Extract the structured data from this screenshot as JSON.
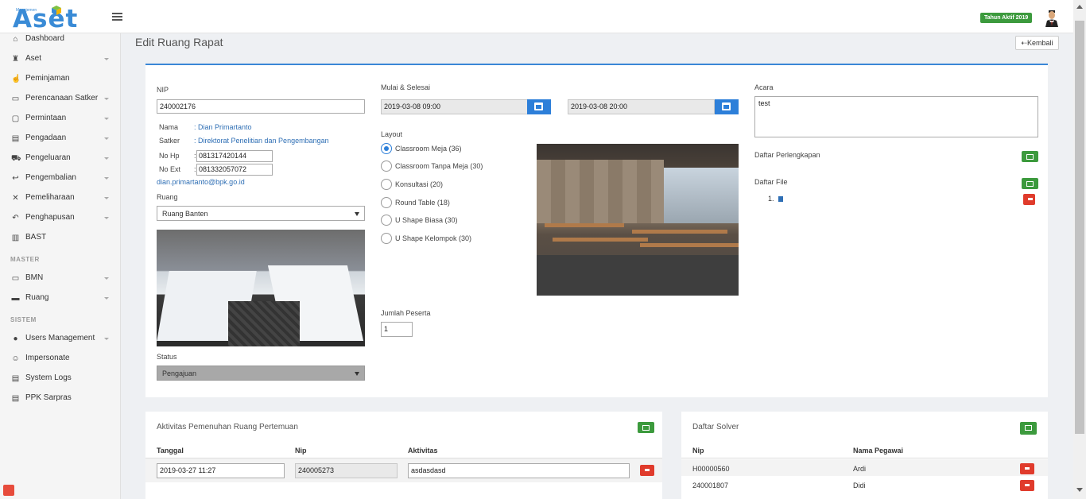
{
  "app": {
    "logo_small": "Manajemen",
    "logo_text": "Aset",
    "tahun_badge": "Tahun Aktif 2019",
    "brand_color": "#3a8bd6",
    "accent_color": "#2d7fd9",
    "success_color": "#3c9a3d",
    "danger_color": "#e03b2c"
  },
  "sidebar": {
    "items": [
      {
        "label": "Dashboard",
        "icon": "home-icon",
        "glyph": "⌂",
        "caret": false
      },
      {
        "label": "Aset",
        "icon": "chair-icon",
        "glyph": "♜",
        "caret": true
      },
      {
        "label": "Peminjaman",
        "icon": "hand-icon",
        "glyph": "☝",
        "caret": false
      },
      {
        "label": "Perencanaan Satker",
        "icon": "keyboard-icon",
        "glyph": "▭",
        "caret": true
      },
      {
        "label": "Permintaan",
        "icon": "clipboard-icon",
        "glyph": "▢",
        "caret": true
      },
      {
        "label": "Pengadaan",
        "icon": "newspaper-icon",
        "glyph": "▤",
        "caret": true
      },
      {
        "label": "Pengeluaran",
        "icon": "truck-icon",
        "glyph": "⛟",
        "caret": true
      },
      {
        "label": "Pengembalian",
        "icon": "return-arrow-icon",
        "glyph": "↩",
        "caret": true
      },
      {
        "label": "Pemeliharaan",
        "icon": "tools-icon",
        "glyph": "✕",
        "caret": true
      },
      {
        "label": "Penghapusan",
        "icon": "undo-icon",
        "glyph": "↶",
        "caret": true
      },
      {
        "label": "BAST",
        "icon": "id-card-icon",
        "glyph": "▥",
        "caret": false
      }
    ],
    "section_master": "MASTER",
    "master_items": [
      {
        "label": "BMN",
        "icon": "monitor-icon",
        "glyph": "▭",
        "caret": true
      },
      {
        "label": "Ruang",
        "icon": "couch-icon",
        "glyph": "▬",
        "caret": true
      }
    ],
    "section_sistem": "SISTEM",
    "sistem_items": [
      {
        "label": "Users Management",
        "icon": "user-icon",
        "glyph": "●",
        "caret": true
      },
      {
        "label": "Impersonate",
        "icon": "mask-icon",
        "glyph": "☺",
        "caret": false
      },
      {
        "label": "System Logs",
        "icon": "list-icon",
        "glyph": "▤",
        "caret": false
      },
      {
        "label": "PPK Sarpras",
        "icon": "list-icon",
        "glyph": "▤",
        "caret": false
      }
    ]
  },
  "page": {
    "title": "Edit Ruang Rapat",
    "back_label": "⇠Kembali"
  },
  "form": {
    "nip_label": "NIP",
    "nip_value": "240002176",
    "nama_key": "Nama",
    "nama_val": ": Dian Primartanto",
    "satker_key": "Satker",
    "satker_val": ": Direktorat Penelitian dan Pengembangan",
    "nohp_key": "No Hp",
    "nohp_sep": ":",
    "nohp_val": "081317420144",
    "noext_key": "No Ext",
    "noext_sep": ":",
    "noext_val": "081332057072",
    "email": "dian.primartanto@bpk.go.id",
    "ruang_label": "Ruang",
    "ruang_value": "Ruang Banten",
    "status_label": "Status",
    "status_value": "Pengajuan",
    "mulai_label": "Mulai & Selesai",
    "mulai_value": "2019-03-08 09:00",
    "selesai_value": "2019-03-08 20:00",
    "layout_label": "Layout",
    "layouts": [
      {
        "label": "Classroom Meja (36)",
        "selected": true
      },
      {
        "label": "Classroom Tanpa Meja (30)",
        "selected": false
      },
      {
        "label": "Konsultasi (20)",
        "selected": false
      },
      {
        "label": "Round Table (18)",
        "selected": false
      },
      {
        "label": "U Shape Biasa (30)",
        "selected": false
      },
      {
        "label": "U Shape Kelompok (30)",
        "selected": false
      }
    ],
    "jumlah_label": "Jumlah Peserta",
    "jumlah_value": "1",
    "acara_label": "Acara",
    "acara_value": "test",
    "perlengkapan_label": "Daftar Perlengkapan",
    "file_label": "Daftar File",
    "file_index": "1."
  },
  "aktivitas": {
    "title": "Aktivitas Pemenuhan Ruang Pertemuan",
    "columns": [
      "Tanggal",
      "Nip",
      "Aktivitas"
    ],
    "rows": [
      {
        "tanggal": "2019-03-27 11:27",
        "nip": "240005273",
        "aktivitas": "asdasdasd"
      }
    ]
  },
  "solver": {
    "title": "Daftar Solver",
    "columns": [
      "Nip",
      "Nama Pegawai"
    ],
    "rows": [
      {
        "nip": "H00000560",
        "nama": "Ardi"
      },
      {
        "nip": "240001807",
        "nama": "Didi"
      }
    ]
  }
}
